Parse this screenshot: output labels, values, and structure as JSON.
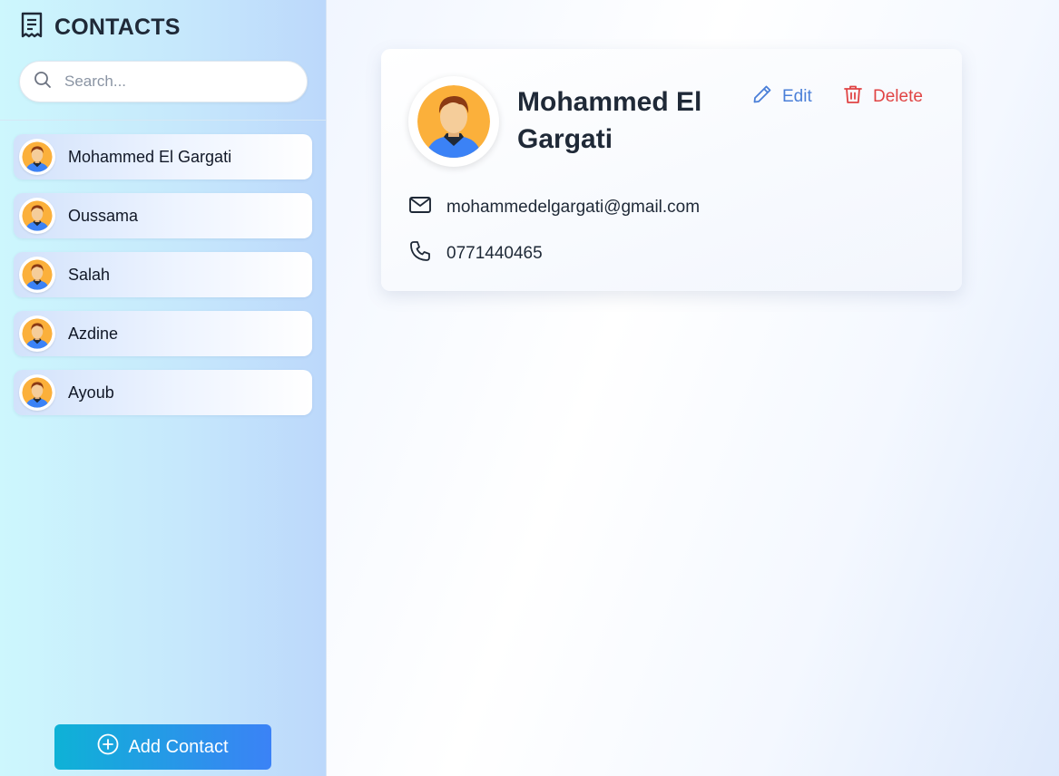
{
  "sidebar": {
    "title": "CONTACTS",
    "title_icon": "contact-book-icon",
    "search": {
      "placeholder": "Search...",
      "value": "",
      "icon": "search-icon"
    },
    "contacts": [
      {
        "name": "Mohammed El Gargati"
      },
      {
        "name": "Oussama"
      },
      {
        "name": "Salah"
      },
      {
        "name": "Azdine"
      },
      {
        "name": "Ayoub"
      }
    ],
    "add_button": {
      "label": "Add Contact",
      "icon": "plus-circle-icon"
    }
  },
  "detail": {
    "name": "Mohammed El Gargati",
    "email": "mohammedelgargati@gmail.com",
    "phone": "0771440465",
    "edit_label": "Edit",
    "delete_label": "Delete",
    "icons": {
      "edit": "pencil-icon",
      "delete": "trash-icon",
      "email": "mail-icon",
      "phone": "phone-icon"
    }
  },
  "colors": {
    "accent_blue": "#4a7fd8",
    "danger_red": "#e04444",
    "button_gradient_start": "#0eb2d6",
    "button_gradient_end": "#3b82f6",
    "avatar_orange": "#fbb03b"
  }
}
